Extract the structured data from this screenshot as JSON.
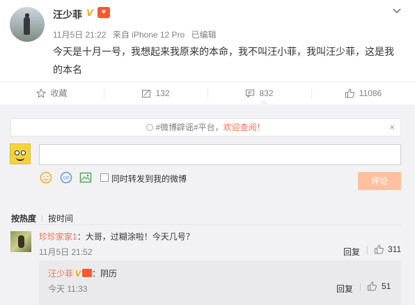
{
  "post": {
    "username": "汪少菲",
    "verified_icon": "V",
    "badge_icon": "gift-badge-icon",
    "date": "11月5日 21:22",
    "source": "来自 iPhone 12 Pro",
    "edited": "已编辑",
    "content": "今天是十月一号，我想起来我原来的本命，我不叫汪小菲，我叫汪少菲，这是我的本名"
  },
  "actions": {
    "favorite_label": "收藏",
    "repost_count": "132",
    "comment_count": "832",
    "like_count": "11086"
  },
  "notice": {
    "prefix": "#微博辟谣#平台，",
    "link": "欢迎查阅！",
    "close": "×"
  },
  "composer": {
    "placeholder": "",
    "repost_label": "同时转发到我的微博",
    "submit_label": "评论"
  },
  "sort": {
    "hot_label": "按热度",
    "time_label": "按时间"
  },
  "comments": [
    {
      "name": "珍珍家家1",
      "text": "：大哥，过糊涂啦！今天几号？",
      "time": "11月5日 21:52",
      "reply_label": "回复",
      "likes": "311",
      "replies": [
        {
          "name": "汪少菲",
          "verified": "V",
          "text": "：阴历",
          "time": "今天 11:33",
          "reply_label": "回复",
          "likes": "51"
        }
      ]
    }
  ],
  "colors": {
    "accent": "#eb7350",
    "verified": "#f7a400",
    "submit_disabled": "#ffc09f",
    "comment_bg": "#f2f2f5"
  }
}
